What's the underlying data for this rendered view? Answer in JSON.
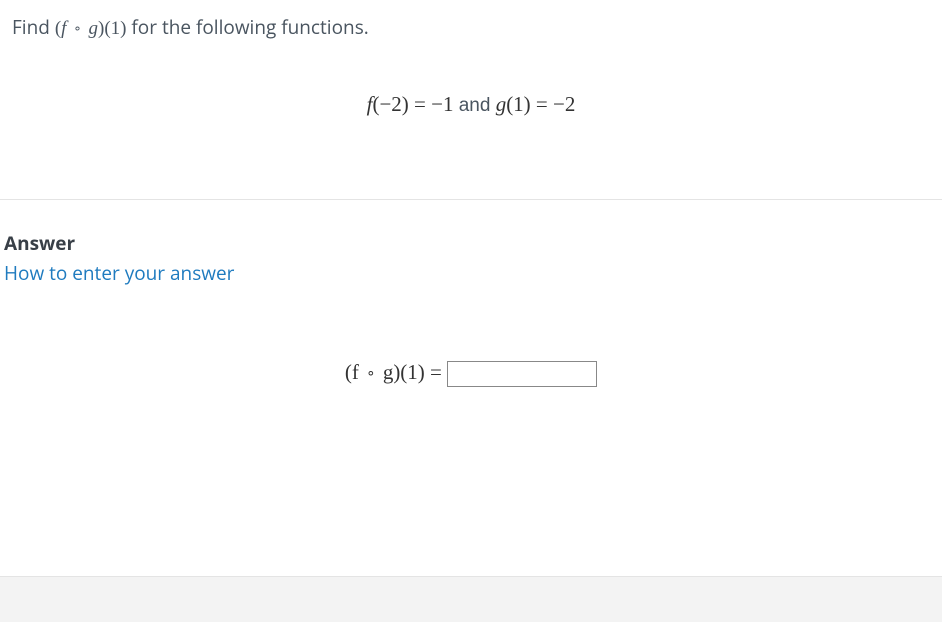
{
  "question": {
    "prompt_prefix": "Find ",
    "composition_expr": "(f ∘ g)(1)",
    "prompt_suffix": " for the following functions.",
    "given_expr": "f(−2) = −1 and g(1) = −2"
  },
  "answer": {
    "heading": "Answer",
    "help_text": "How to enter your answer",
    "label_expr": "(f ∘ g)(1) =",
    "input_value": ""
  }
}
